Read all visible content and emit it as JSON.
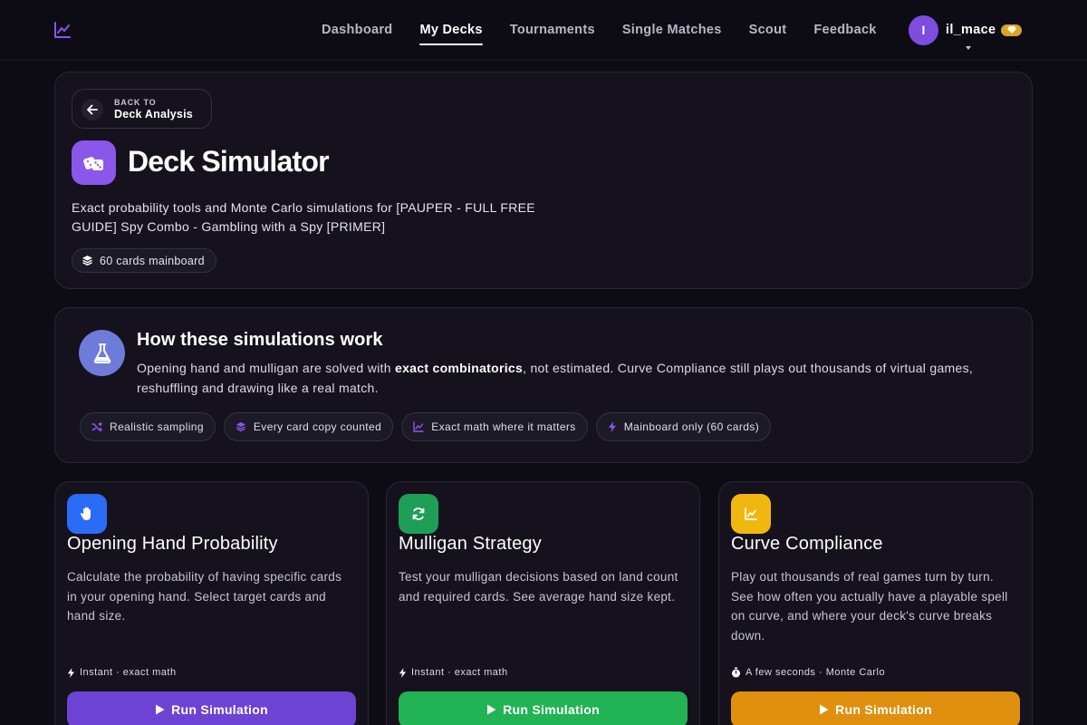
{
  "nav": {
    "brand_icon": "trend-chart-icon",
    "links": [
      "Dashboard",
      "My Decks",
      "Tournaments",
      "Single Matches",
      "Scout",
      "Feedback"
    ],
    "active_index": 1,
    "user": {
      "initial": "I",
      "name": "il_mace",
      "badge_icon": "diamond-icon"
    }
  },
  "hero": {
    "back_small": "BACK TO",
    "back_big": "Deck Analysis",
    "title": "Deck Simulator",
    "description": "Exact probability tools and Monte Carlo simulations for [PAUPER - FULL FREE GUIDE] Spy Combo - Gambling with a Spy [PRIMER]",
    "card_count": "60 cards mainboard"
  },
  "how": {
    "title": "How these simulations work",
    "text_pre": "Opening hand and mulligan are solved with ",
    "text_bold": "exact combinatorics",
    "text_post": ", not estimated. Curve Compliance still plays out thousands of virtual games, reshuffling and drawing like a real match.",
    "chips": [
      "Realistic sampling",
      "Every card copy counted",
      "Exact math where it matters",
      "Mainboard only (60 cards)"
    ]
  },
  "simulations": [
    {
      "title": "Opening Hand Probability",
      "description": "Calculate the probability of having specific cards in your opening hand. Select target cards and hand size.",
      "meta": "Instant · exact math",
      "button": "Run Simulation",
      "icon": "hand-icon",
      "color": "#2b6cf6"
    },
    {
      "title": "Mulligan Strategy",
      "description": "Test your mulligan decisions based on land count and required cards. See average hand size kept.",
      "meta": "Instant · exact math",
      "button": "Run Simulation",
      "icon": "refresh-icon",
      "color": "#1f9e57"
    },
    {
      "title": "Curve Compliance",
      "description": "Play out thousands of real games turn by turn. See how often you actually have a playable spell on curve, and where your deck's curve breaks down.",
      "meta": "A few seconds · Monte Carlo",
      "button": "Run Simulation",
      "icon": "curve-chart-icon",
      "color": "#f0b80f"
    }
  ],
  "colors": {
    "accent": "#8b57ea",
    "run_opening": "#6e43d4",
    "run_mulligan": "#22b354",
    "run_curve": "#e08f0e"
  }
}
